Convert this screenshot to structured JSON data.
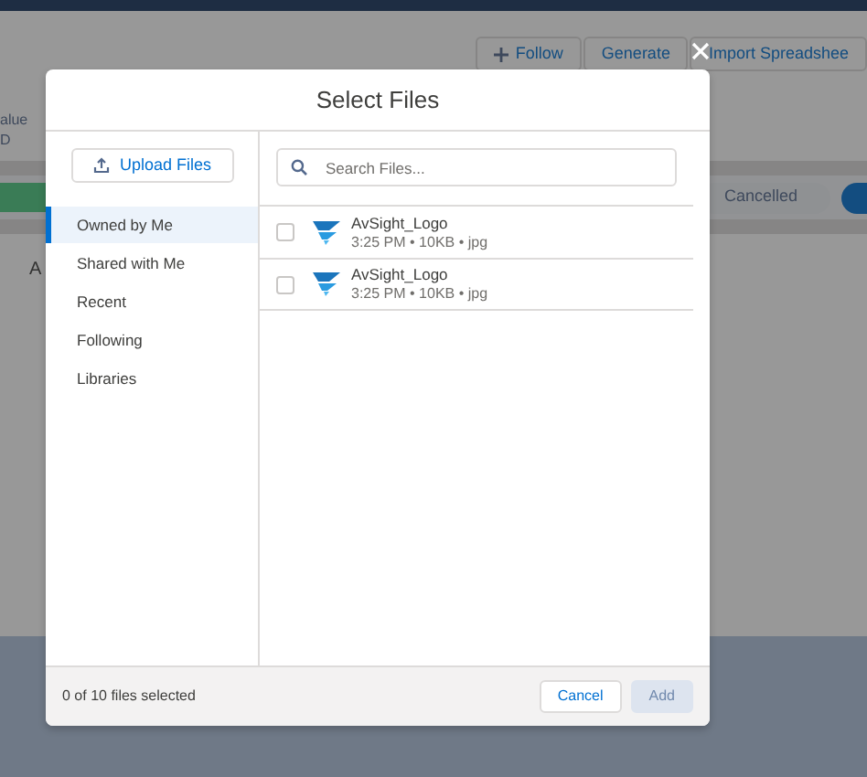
{
  "background": {
    "header_buttons": [
      {
        "label": "Follow",
        "kind": "add"
      },
      {
        "label": "Generate",
        "kind": "plain"
      },
      {
        "label": "Import Spreadshee",
        "kind": "plain"
      }
    ],
    "field_label": "alue",
    "field_value": "D",
    "status": "Cancelled",
    "column_heading": "A"
  },
  "modal": {
    "title": "Select Files",
    "upload_button": "Upload Files",
    "sidebar": [
      {
        "label": "Owned by Me",
        "selected": true
      },
      {
        "label": "Shared with Me",
        "selected": false
      },
      {
        "label": "Recent",
        "selected": false
      },
      {
        "label": "Following",
        "selected": false
      },
      {
        "label": "Libraries",
        "selected": false
      }
    ],
    "search": {
      "placeholder": "Search Files..."
    },
    "files": [
      {
        "name": "AvSight_Logo",
        "meta": "3:25 PM • 10KB • jpg",
        "checked": false
      },
      {
        "name": "AvSight_Logo",
        "meta": "3:25 PM • 10KB • jpg",
        "checked": false
      }
    ],
    "footer": {
      "selection_count": "0 of 10 files selected",
      "buttons": [
        {
          "label": "Cancel",
          "disabled": false
        },
        {
          "label": "Add",
          "disabled": true
        }
      ]
    }
  }
}
